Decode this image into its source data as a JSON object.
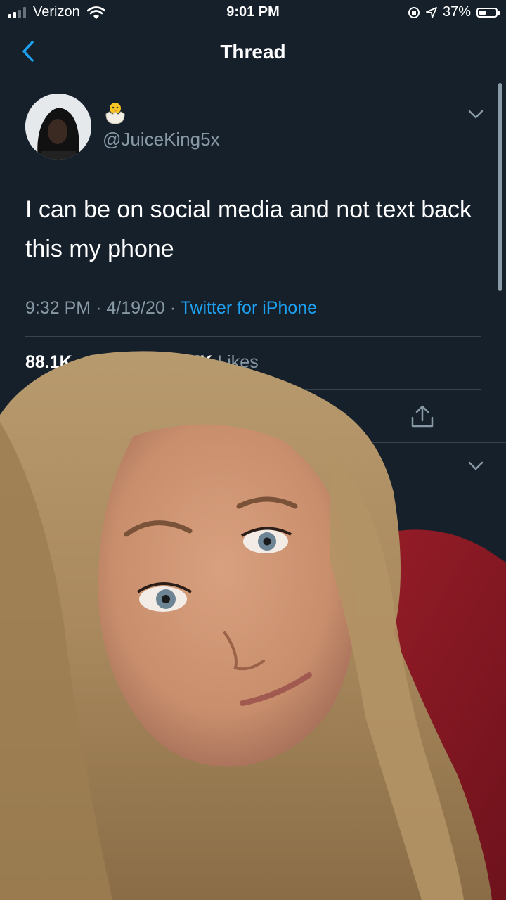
{
  "status_bar": {
    "carrier": "Verizon",
    "time": "9:01 PM",
    "battery": "37%"
  },
  "header": {
    "title": "Thread"
  },
  "tweet": {
    "emoji": "🐣",
    "handle": "@JuiceKing5x",
    "text": "I can be on social media and not text back this my phone",
    "time": "9:32 PM",
    "separator": "·",
    "date": "4/19/20",
    "source": "Twitter for iPhone",
    "retweets_count": "88.1K",
    "likes_count": "297K",
    "likes_label": "Likes"
  },
  "icons": [
    "signal-bars-icon",
    "wifi-icon",
    "orientation-lock-icon",
    "location-arrow-icon",
    "battery-icon",
    "back-chevron-icon",
    "chevron-down-icon",
    "heart-icon",
    "share-icon"
  ],
  "colors": {
    "background": "#15202b",
    "accent": "#1da1f2",
    "secondary_text": "#8899a6",
    "divider": "#38444d",
    "like": "#e0245e"
  }
}
